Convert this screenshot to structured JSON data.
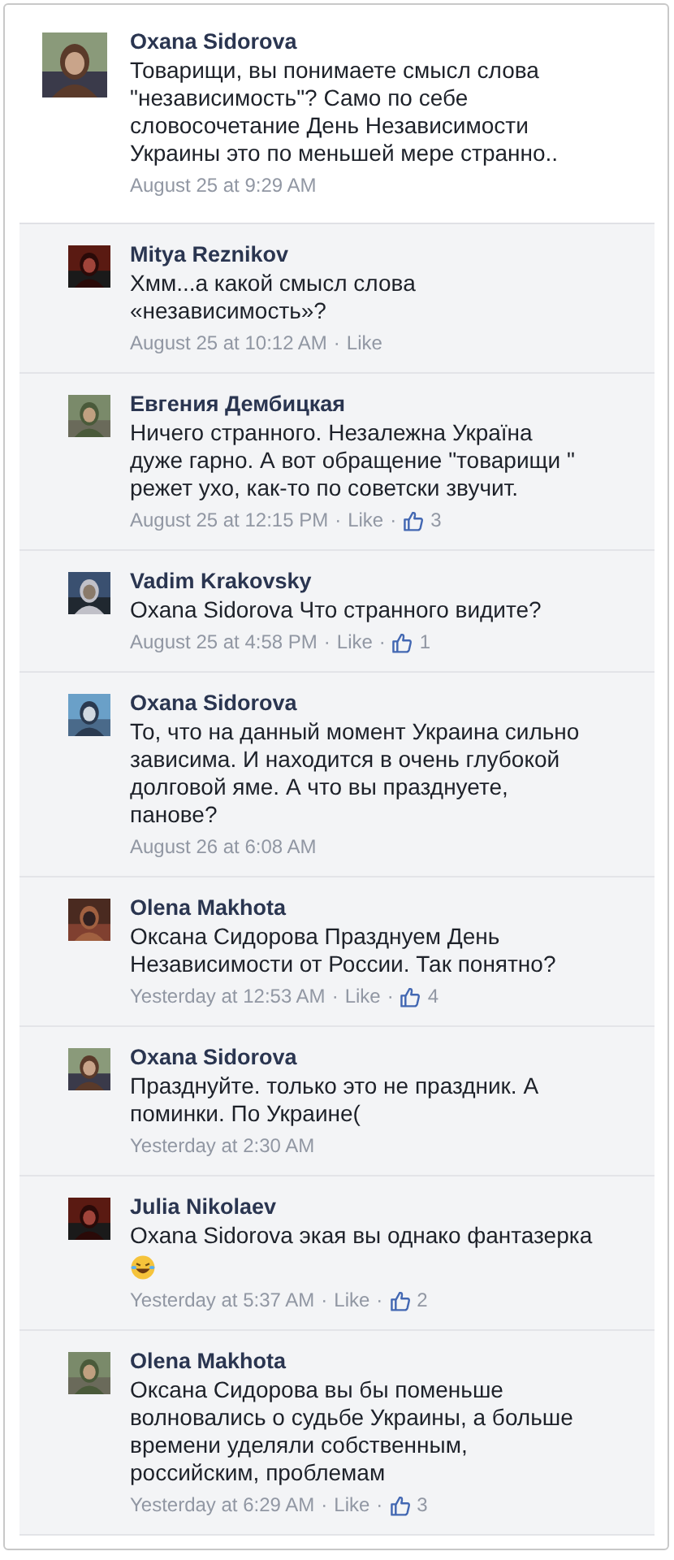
{
  "comments": [
    {
      "kind": "top",
      "name": "Oxana Sidorova",
      "text": "Товарищи, вы понимаете смысл слова\n\"независимость\"? Само по себе\nсловосочетание День Независимости\nУкраины это по меньшей мере странно..",
      "time": "August 25 at 9:29 AM"
    },
    {
      "kind": "reply",
      "name": "Mitya Reznikov",
      "text": "Хмм...а какой смысл слова\n«независимость»?",
      "time": "August 25 at 10:12 AM",
      "like": "Like",
      "sep": "·"
    },
    {
      "kind": "reply",
      "name": "Евгения Дембицкая",
      "text": "Ничего странного. Незалежна Украïна\nдуже гарно. А вот обращение \"товарищи \"\nрежет ухо, как-то по советски звучит.",
      "time": "August 25 at 12:15 PM",
      "like": "Like",
      "likes": "3",
      "sep": "·"
    },
    {
      "kind": "reply",
      "name": "Vadim Krakovsky",
      "text": "Oxana Sidorova Что странного видите?",
      "time": "August 25 at 4:58 PM",
      "like": "Like",
      "likes": "1",
      "sep": "·"
    },
    {
      "kind": "reply",
      "name": "Oxana Sidorova",
      "text": "То, что на данный момент Украина сильно\nзависима. И находится в очень глубокой\nдолговой яме. А что вы празднуете,\nпанове?",
      "time": "August 26 at 6:08 AM"
    },
    {
      "kind": "reply",
      "name": "Olena Makhota",
      "text": "Оксана Сидорова Празднуем День\nНезависимости от России. Так понятно?",
      "time": "Yesterday at 12:53 AM",
      "like": "Like",
      "likes": "4",
      "sep": "·"
    },
    {
      "kind": "reply",
      "name": "Oxana Sidorova",
      "text": "Празднуйте. только это не праздник. А\nпоминки. По Украине(",
      "time": "Yesterday at 2:30 AM"
    },
    {
      "kind": "reply",
      "name": "Julia Nikolaev",
      "text": "Oxana Sidorova экая вы однако фантазерка",
      "time": "Yesterday at 5:37 AM",
      "like": "Like",
      "likes": "2",
      "sep": "·",
      "emoji": true
    },
    {
      "kind": "reply",
      "name": "Olena Makhota",
      "text": "Оксана Сидорова вы бы поменьше\nволновались о судьбе Украины, а больше\nвремени уделяли собственным,\nроссийским, проблемам",
      "time": "Yesterday at 6:29 AM",
      "like": "Like",
      "likes": "3",
      "sep": "·"
    }
  ]
}
